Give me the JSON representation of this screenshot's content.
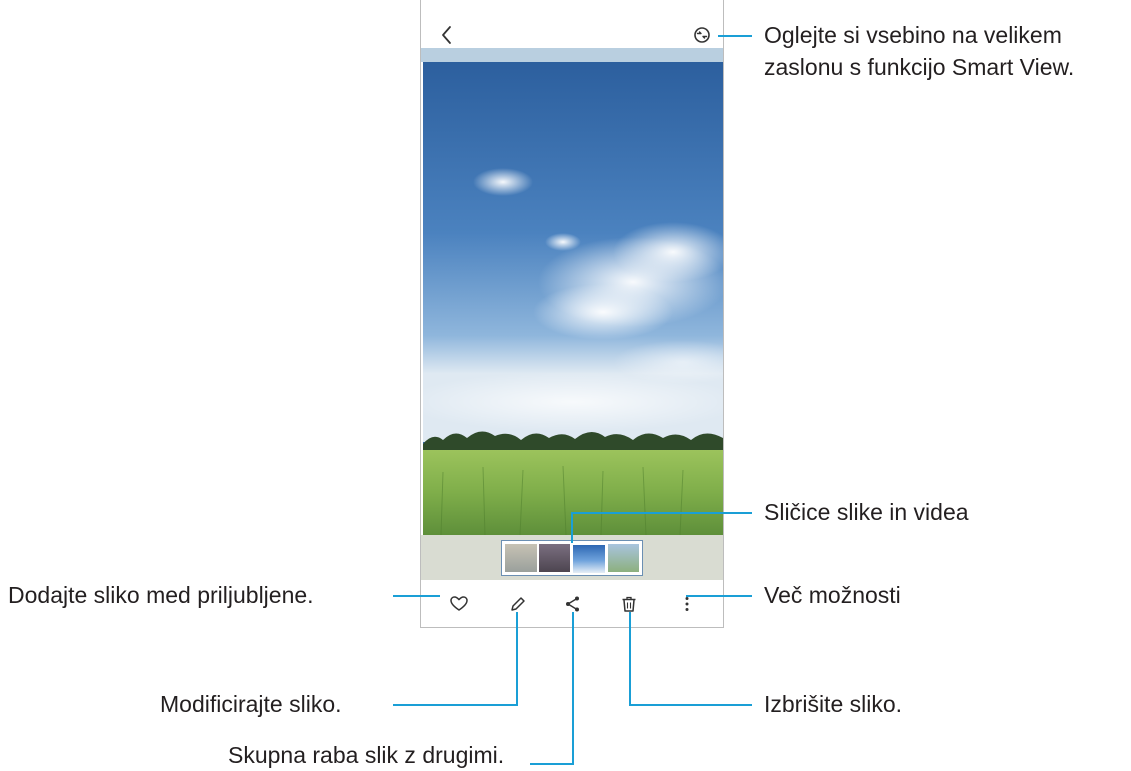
{
  "callouts": {
    "smart_view": "Oglejte si vsebino na velikem",
    "smart_view_line2": "zaslonu s funkcijo Smart View.",
    "thumbnails": "Sličice slike in videa",
    "favorite": "Dodajte sliko med priljubljene.",
    "more_options": "Več možnosti",
    "edit": "Modificirajte sliko.",
    "delete": "Izbrišite sliko.",
    "share": "Skupna raba slik z drugimi."
  },
  "icons": {
    "back": "chevron-left-icon",
    "smart_view": "smart-view-icon",
    "favorite": "heart-icon",
    "edit": "pencil-icon",
    "share": "share-icon",
    "delete": "trash-icon",
    "more": "more-vertical-icon"
  },
  "colors": {
    "callout_line": "#1a9fd6",
    "sky": "#3c6faa",
    "grass": "#7fae4a"
  }
}
